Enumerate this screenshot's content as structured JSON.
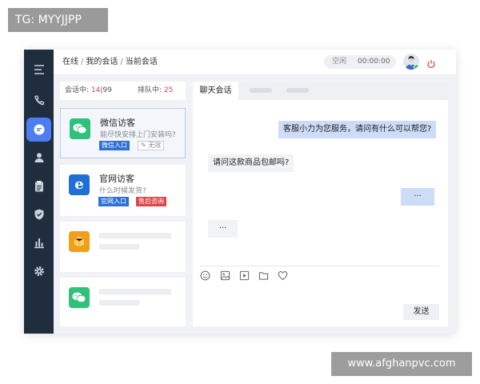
{
  "watermarks": {
    "top_left": "TG: MYYJJPP",
    "bottom_right": "www.afghanpvc.com"
  },
  "sidebar": {
    "items": [
      {
        "icon": "menu-icon"
      },
      {
        "icon": "phone-icon"
      },
      {
        "icon": "chat-icon",
        "active": true
      },
      {
        "icon": "user-icon"
      },
      {
        "icon": "clipboard-icon"
      },
      {
        "icon": "shield-icon"
      },
      {
        "icon": "bar-chart-icon"
      },
      {
        "icon": "settings-icon"
      }
    ]
  },
  "header": {
    "breadcrumb": [
      "在线",
      "我的会话",
      "当前会话"
    ],
    "separator": "/",
    "status_label": "空闲",
    "timer": "00:00:00",
    "avatar_icon": "agent-avatar",
    "power_icon": "power-icon"
  },
  "session_list": {
    "current_label": "会话中:",
    "current_count": "14",
    "count_sep": "|",
    "max_count": "99",
    "queue_label": "排队中:",
    "queue_count": "25",
    "cards": [
      {
        "title": "微信访客",
        "message": "能尽快安排上门安装吗?",
        "tags": [
          "微信入口",
          "无效"
        ],
        "icon": "wechat-icon",
        "selected": true
      },
      {
        "title": "官网访客",
        "message": "什么时候发货?",
        "tags": [
          "官网入口",
          "售后咨询"
        ],
        "icon": "ie-browser-icon"
      },
      {
        "icon": "package-icon"
      },
      {
        "icon": "wechat-icon"
      }
    ]
  },
  "chat": {
    "tab_active": "聊天会话",
    "messages": [
      {
        "from": "agent",
        "text": "客服小力为您服务，请问有什么可以帮您?"
      },
      {
        "from": "visitor",
        "text": "请问这款商品包邮吗?"
      },
      {
        "from": "agent",
        "text": "···"
      },
      {
        "from": "visitor",
        "text": "···"
      }
    ],
    "toolbar_icons": [
      "emoji-icon",
      "image-icon",
      "video-icon",
      "folder-icon",
      "heart-icon"
    ],
    "send_label": "发送"
  },
  "colors": {
    "sidebar_bg": "#1f2d3d",
    "accent": "#4e7cf1",
    "alert_red": "#e0454a",
    "wechat_green": "#2fc07a",
    "ie_blue": "#1f6fd6",
    "package_orange": "#f0a018"
  }
}
